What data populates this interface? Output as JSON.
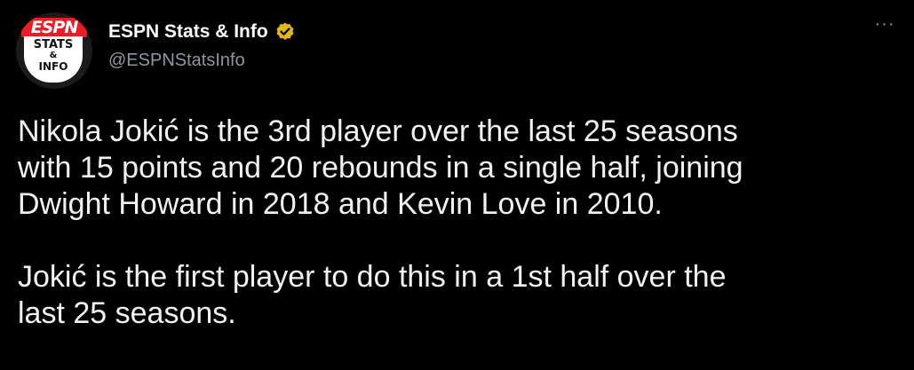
{
  "author": {
    "display_name": "ESPN Stats & Info",
    "handle": "@ESPNStatsInfo",
    "verified": true,
    "avatar": {
      "logo_text": "ESPN",
      "line1": "STATS",
      "line2": "&",
      "line3": "INFO",
      "brand_color": "#e81d25"
    }
  },
  "more_menu": {
    "icon": "more-icon",
    "label": "···"
  },
  "tweet": {
    "paragraph1": "Nikola Jokić is the 3rd player over the last 25 seasons\nwith 15 points and 20 rebounds in a single half, joining\nDwight Howard in 2018 and Kevin Love in 2010.",
    "paragraph2": "Jokić is the first player to do this in a 1st half over the\nlast 25 seasons."
  },
  "colors": {
    "background": "#000000",
    "text": "#f2f2f2",
    "muted": "#8b98a5",
    "verified_badge": "#e2b719"
  }
}
